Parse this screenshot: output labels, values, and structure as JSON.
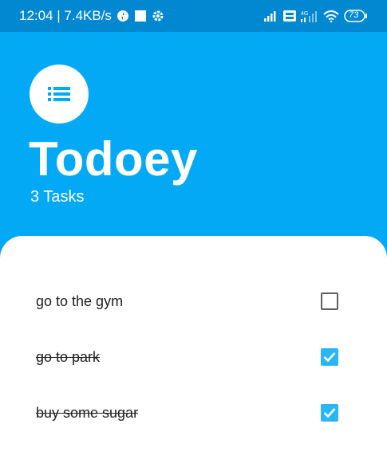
{
  "status_bar": {
    "time_speed": "12:04 | 7.4KB/s",
    "battery": "73",
    "icons": [
      "sync-icon",
      "square-icon",
      "gear-icon",
      "signal-icon",
      "volte-icon",
      "signal-4g-icon",
      "wifi-icon",
      "battery-icon"
    ]
  },
  "header": {
    "menu_icon": "list-icon",
    "title": "Todoey",
    "task_count": "3 Tasks"
  },
  "tasks": [
    {
      "label": "go to the gym",
      "checked": false
    },
    {
      "label": "go to park",
      "checked": true
    },
    {
      "label": "buy some sugar",
      "checked": true
    }
  ],
  "colors": {
    "primary": "#03a9f4",
    "status_bar": "#0288d1",
    "checkbox_checked": "#29b6f6"
  }
}
